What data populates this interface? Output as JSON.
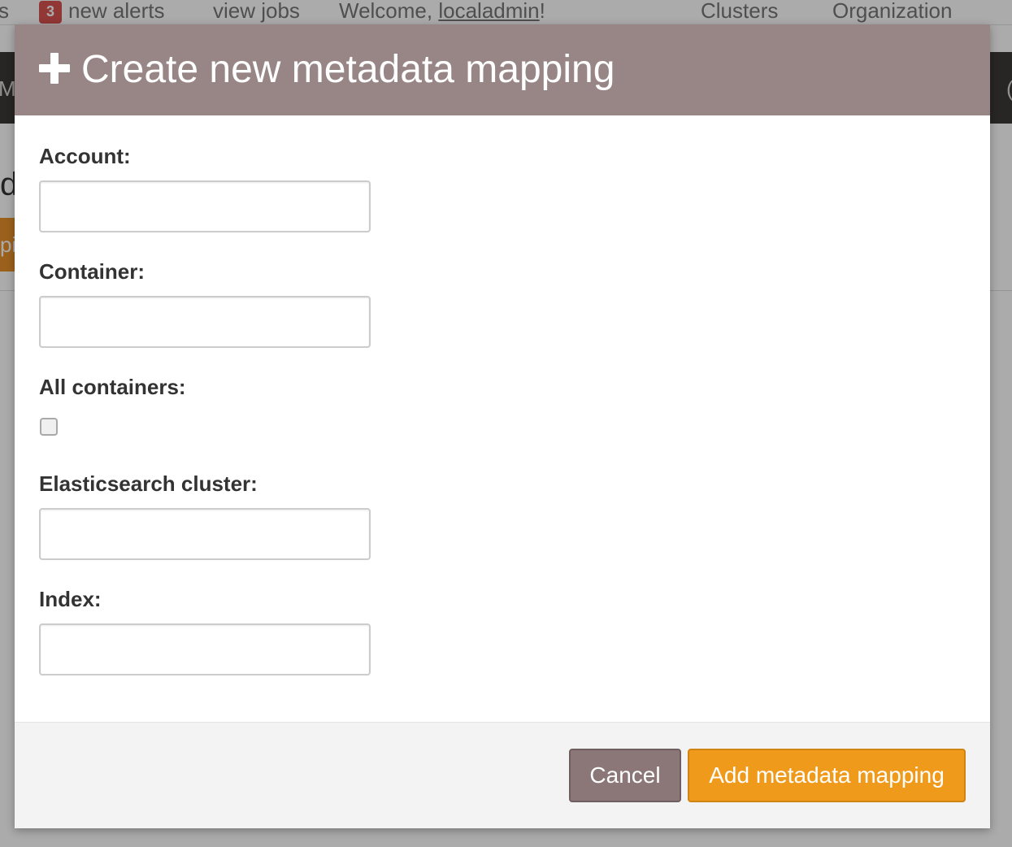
{
  "background_page": {
    "topbar": {
      "left_fragment": "s",
      "alerts_count": "3",
      "alerts_label": "new alerts",
      "view_jobs": "view jobs",
      "welcome_prefix": "Welcome, ",
      "welcome_user": "localadmin",
      "welcome_suffix": "!",
      "clusters": "Clusters",
      "organization": "Organization"
    },
    "navbar": {
      "left_fragment": "M",
      "right_fragment": "("
    },
    "heading_fragment": "da",
    "button_fragment": "pi"
  },
  "modal": {
    "title": "Create new metadata mapping",
    "icon": "plus-icon",
    "fields": {
      "account": {
        "label": "Account:",
        "value": "",
        "placeholder": ""
      },
      "container": {
        "label": "Container:",
        "value": "",
        "placeholder": ""
      },
      "all_containers": {
        "label": "All containers:",
        "checked": false
      },
      "cluster": {
        "label": "Elasticsearch cluster:",
        "value": "",
        "placeholder": ""
      },
      "index": {
        "label": "Index:",
        "value": "",
        "placeholder": ""
      }
    },
    "buttons": {
      "cancel": "Cancel",
      "submit": "Add metadata mapping"
    }
  },
  "colors": {
    "header": "#988687",
    "cancel_button": "#8b7678",
    "submit_button": "#ef9a1a",
    "alert_badge": "#d9534f",
    "navbar": "#3c3a36"
  }
}
